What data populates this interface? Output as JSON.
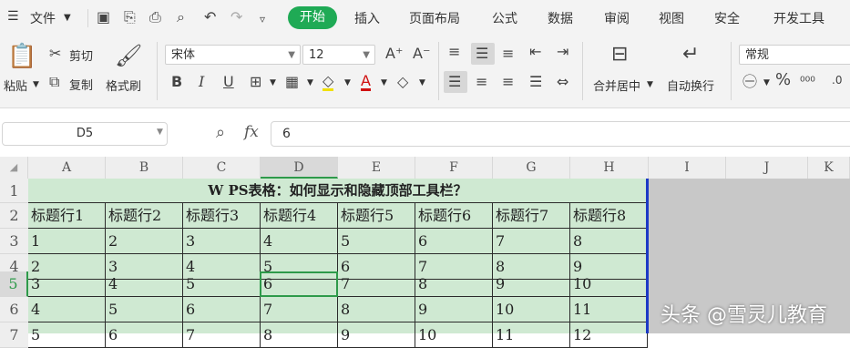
{
  "menubar": {
    "file_menu": "文件",
    "tabs": [
      "开始",
      "插入",
      "页面布局",
      "公式",
      "数据",
      "审阅",
      "视图",
      "安全",
      "开发工具"
    ],
    "active_tab": "开始",
    "accent_color": "#1faa55"
  },
  "ribbon": {
    "paste_label": "粘贴",
    "cut_label": "剪切",
    "copy_label": "复制",
    "format_painter_label": "格式刷",
    "font_name": "宋体",
    "font_size": "12",
    "merge_center_label": "合并居中",
    "wrap_text_label": "自动换行",
    "number_format": "常规"
  },
  "formula_bar": {
    "name_box": "D5",
    "fx_label": "fx",
    "value": "6"
  },
  "sheet": {
    "columns": [
      "A",
      "B",
      "C",
      "D",
      "E",
      "F",
      "G",
      "H",
      "I",
      "J",
      "K"
    ],
    "rows": [
      "1",
      "2",
      "3",
      "4",
      "5",
      "6",
      "7"
    ],
    "title": "W PS表格：如何显示和隐藏顶部工具栏？",
    "headers": [
      "标题行1",
      "标题行2",
      "标题行3",
      "标题行4",
      "标题行5",
      "标题行6",
      "标题行7",
      "标题行8"
    ],
    "data": [
      [
        "1",
        "2",
        "3",
        "4",
        "5",
        "6",
        "7",
        "8"
      ],
      [
        "2",
        "3",
        "4",
        "5",
        "6",
        "7",
        "8",
        "9"
      ],
      [
        "3",
        "4",
        "5",
        "6",
        "7",
        "8",
        "9",
        "10"
      ],
      [
        "4",
        "5",
        "6",
        "7",
        "8",
        "9",
        "10",
        "11"
      ],
      [
        "5",
        "6",
        "7",
        "8",
        "9",
        "10",
        "11",
        "12"
      ]
    ],
    "active_cell": "D5",
    "fill_color": "#cfe9d2"
  },
  "watermark": "头条 @雪灵儿教育"
}
